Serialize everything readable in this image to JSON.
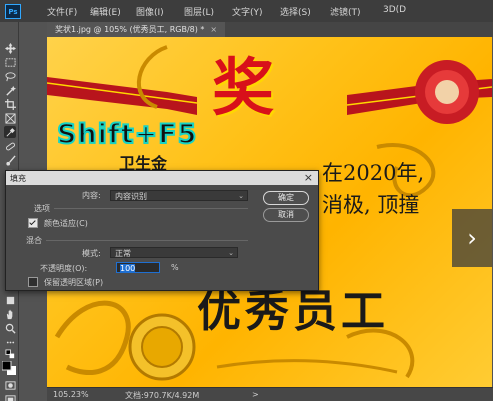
{
  "menubar": {
    "logo": "Ps",
    "items": [
      "文件(F)",
      "编辑(E)",
      "图像(I)",
      "图层(L)",
      "文字(Y)",
      "选择(S)",
      "滤镜(T)",
      "3D(D"
    ]
  },
  "document": {
    "tab_label": "奖状1.jpg @ 105% (优秀员工, RGB/8) *",
    "close_glyph": "×"
  },
  "canvas": {
    "jiang": "奖",
    "shortcut_overlay": "Shift+F5",
    "signature": "卫生金",
    "line1": "在2020年,",
    "line2": "消极, 顶撞",
    "award": "优秀员工",
    "next_glyph": "›"
  },
  "statusbar": {
    "zoom": "105.23%",
    "doc_info": "文档:970.7K/4.92M",
    "arrow": ">"
  },
  "dialog": {
    "title": "填充",
    "close": "×",
    "content_label": "内容:",
    "content_value": "内容识别",
    "options_group": "选项",
    "color_adapt_label": "颜色适应(C)",
    "color_adapt_checked": true,
    "blend_group": "混合",
    "mode_label": "模式:",
    "mode_value": "正常",
    "opacity_label": "不透明度(O):",
    "opacity_value": "100",
    "opacity_unit": "%",
    "preserve_label": "保留透明区域(P)",
    "preserve_checked": false,
    "ok_label": "确定",
    "cancel_label": "取消"
  },
  "colors": {
    "accent": "#31a8ff",
    "canvas_gold": "#ffc21a",
    "ribbon_red": "#d8101a",
    "shortcut_outline": "#17d3c5"
  },
  "tools": [
    "move-icon",
    "marquee-icon",
    "lasso-icon",
    "magic-wand-icon",
    "crop-icon",
    "frame-icon",
    "eyedropper-icon",
    "healing-icon",
    "brush-icon",
    "stamp-icon",
    "history-brush-icon",
    "eraser-icon",
    "gradient-icon",
    "blur-icon",
    "dodge-icon",
    "pen-icon",
    "type-icon",
    "path-select-icon",
    "shape-icon",
    "hand-icon",
    "zoom-icon",
    "edit-toolbar-icon",
    "default-colors-icon",
    "foreground-color-icon",
    "quick-mask-icon",
    "screen-mode-icon"
  ]
}
